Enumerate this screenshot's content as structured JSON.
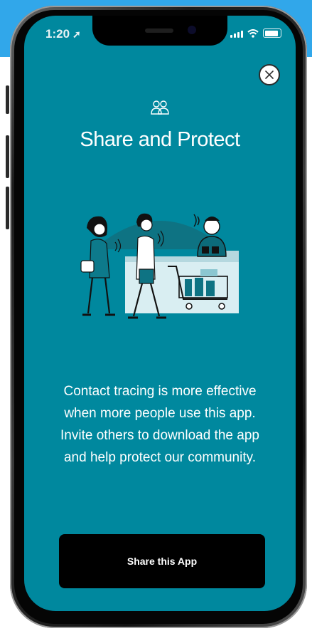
{
  "status_bar": {
    "time": "1:20",
    "location_icon": "location-arrow-icon",
    "signal_icon": "cellular-signal-icon",
    "wifi_icon": "wifi-icon",
    "battery_icon": "battery-icon"
  },
  "modal": {
    "close_icon": "close-icon",
    "header_icon": "people-icon",
    "title": "Share and Protect",
    "illustration": "contact-tracing-checkout-illustration",
    "description": "Contact tracing is more effective when more people use this app. Invite others to download the app and help protect our community.",
    "share_button_label": "Share this App"
  },
  "colors": {
    "screen_background": "#00889e",
    "button_background": "#000000",
    "text": "#ffffff",
    "backdrop_band": "#31a7ea"
  }
}
